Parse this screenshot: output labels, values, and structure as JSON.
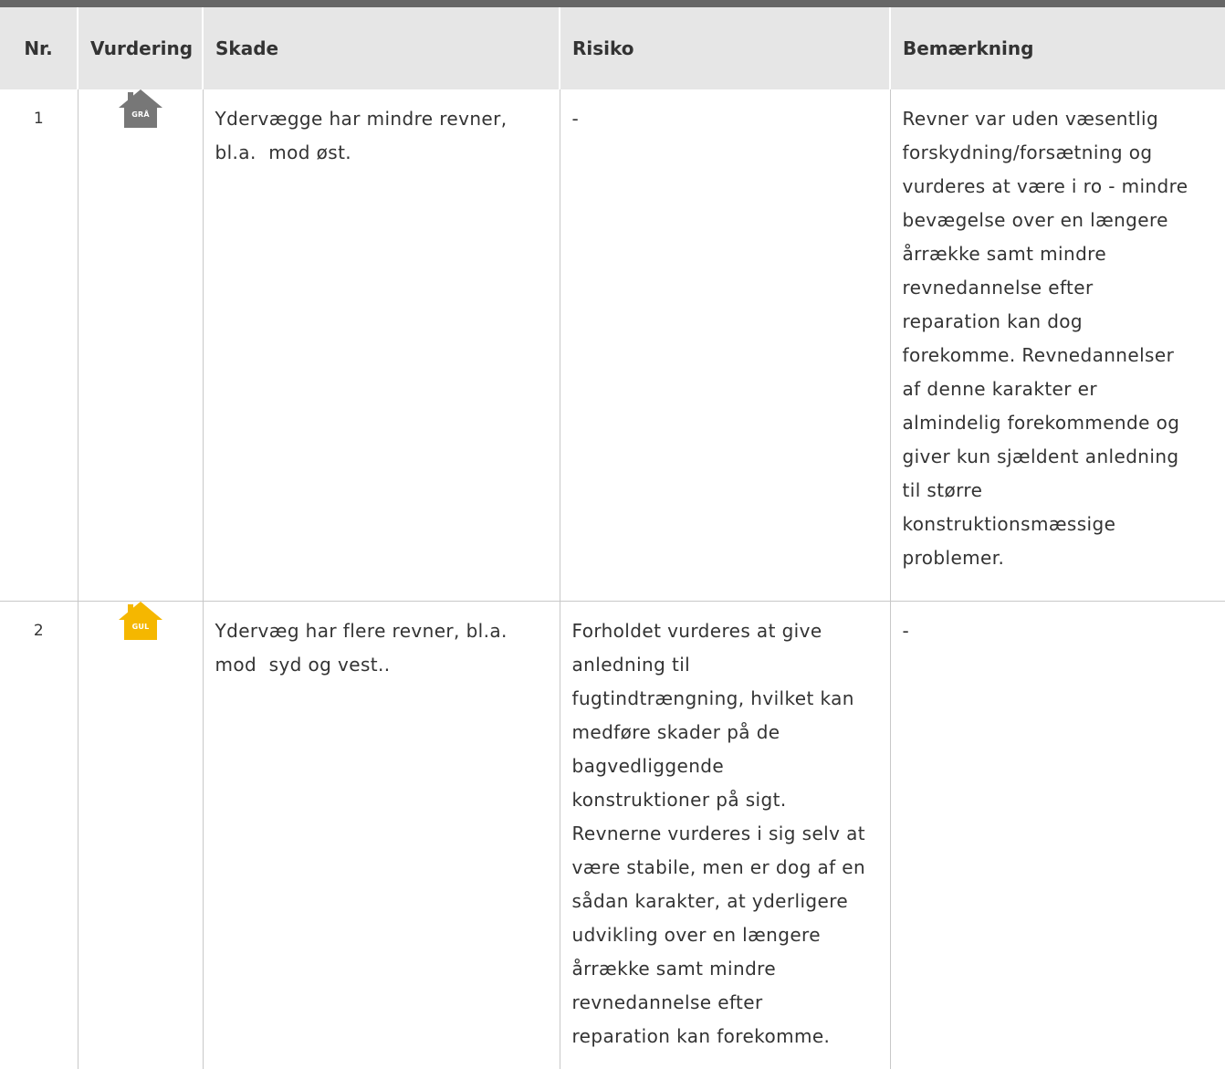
{
  "table": {
    "headers": {
      "nr": "Nr.",
      "vurdering": "Vurdering",
      "skade": "Skade",
      "risiko": "Risiko",
      "bemaerkning": "Bemærkning"
    },
    "rows": [
      {
        "nr": "1",
        "vurdering": {
          "icon": "house-icon",
          "label": "GRÅ",
          "color": "#777777"
        },
        "skade": [
          "Ydervægge har mindre revner,",
          "bl.a.  mod øst."
        ],
        "risiko": [
          "-"
        ],
        "bemaerkning": [
          "Revner var uden væsentlig",
          "forskydning/forsætning og",
          "vurderes at være i ro - mindre",
          "bevægelse over en længere",
          "årrække samt mindre",
          "revnedannelse efter",
          "reparation kan dog",
          "forekomme. Revnedannelser",
          "af denne karakter er",
          "almindelig forekommende og",
          "giver kun sjældent anledning",
          "til større",
          "konstruktionsmæssige",
          "problemer."
        ]
      },
      {
        "nr": "2",
        "vurdering": {
          "icon": "house-icon",
          "label": "GUL",
          "color": "#f5b700"
        },
        "skade": [
          "Ydervæg har flere revner, bl.a.",
          "mod  syd og vest.."
        ],
        "risiko": [
          "Forholdet vurderes at give",
          "anledning til",
          "fugtindtrængning, hvilket kan",
          "medføre skader på de",
          "bagvedliggende",
          "konstruktioner på sigt.",
          "Revnerne vurderes i sig selv at",
          "være stabile, men er dog af en",
          "sådan karakter, at yderligere",
          "udvikling over en længere",
          "årrække samt mindre",
          "revnedannelse efter",
          "reparation kan forekomme."
        ],
        "bemaerkning": [
          "-"
        ]
      }
    ]
  }
}
